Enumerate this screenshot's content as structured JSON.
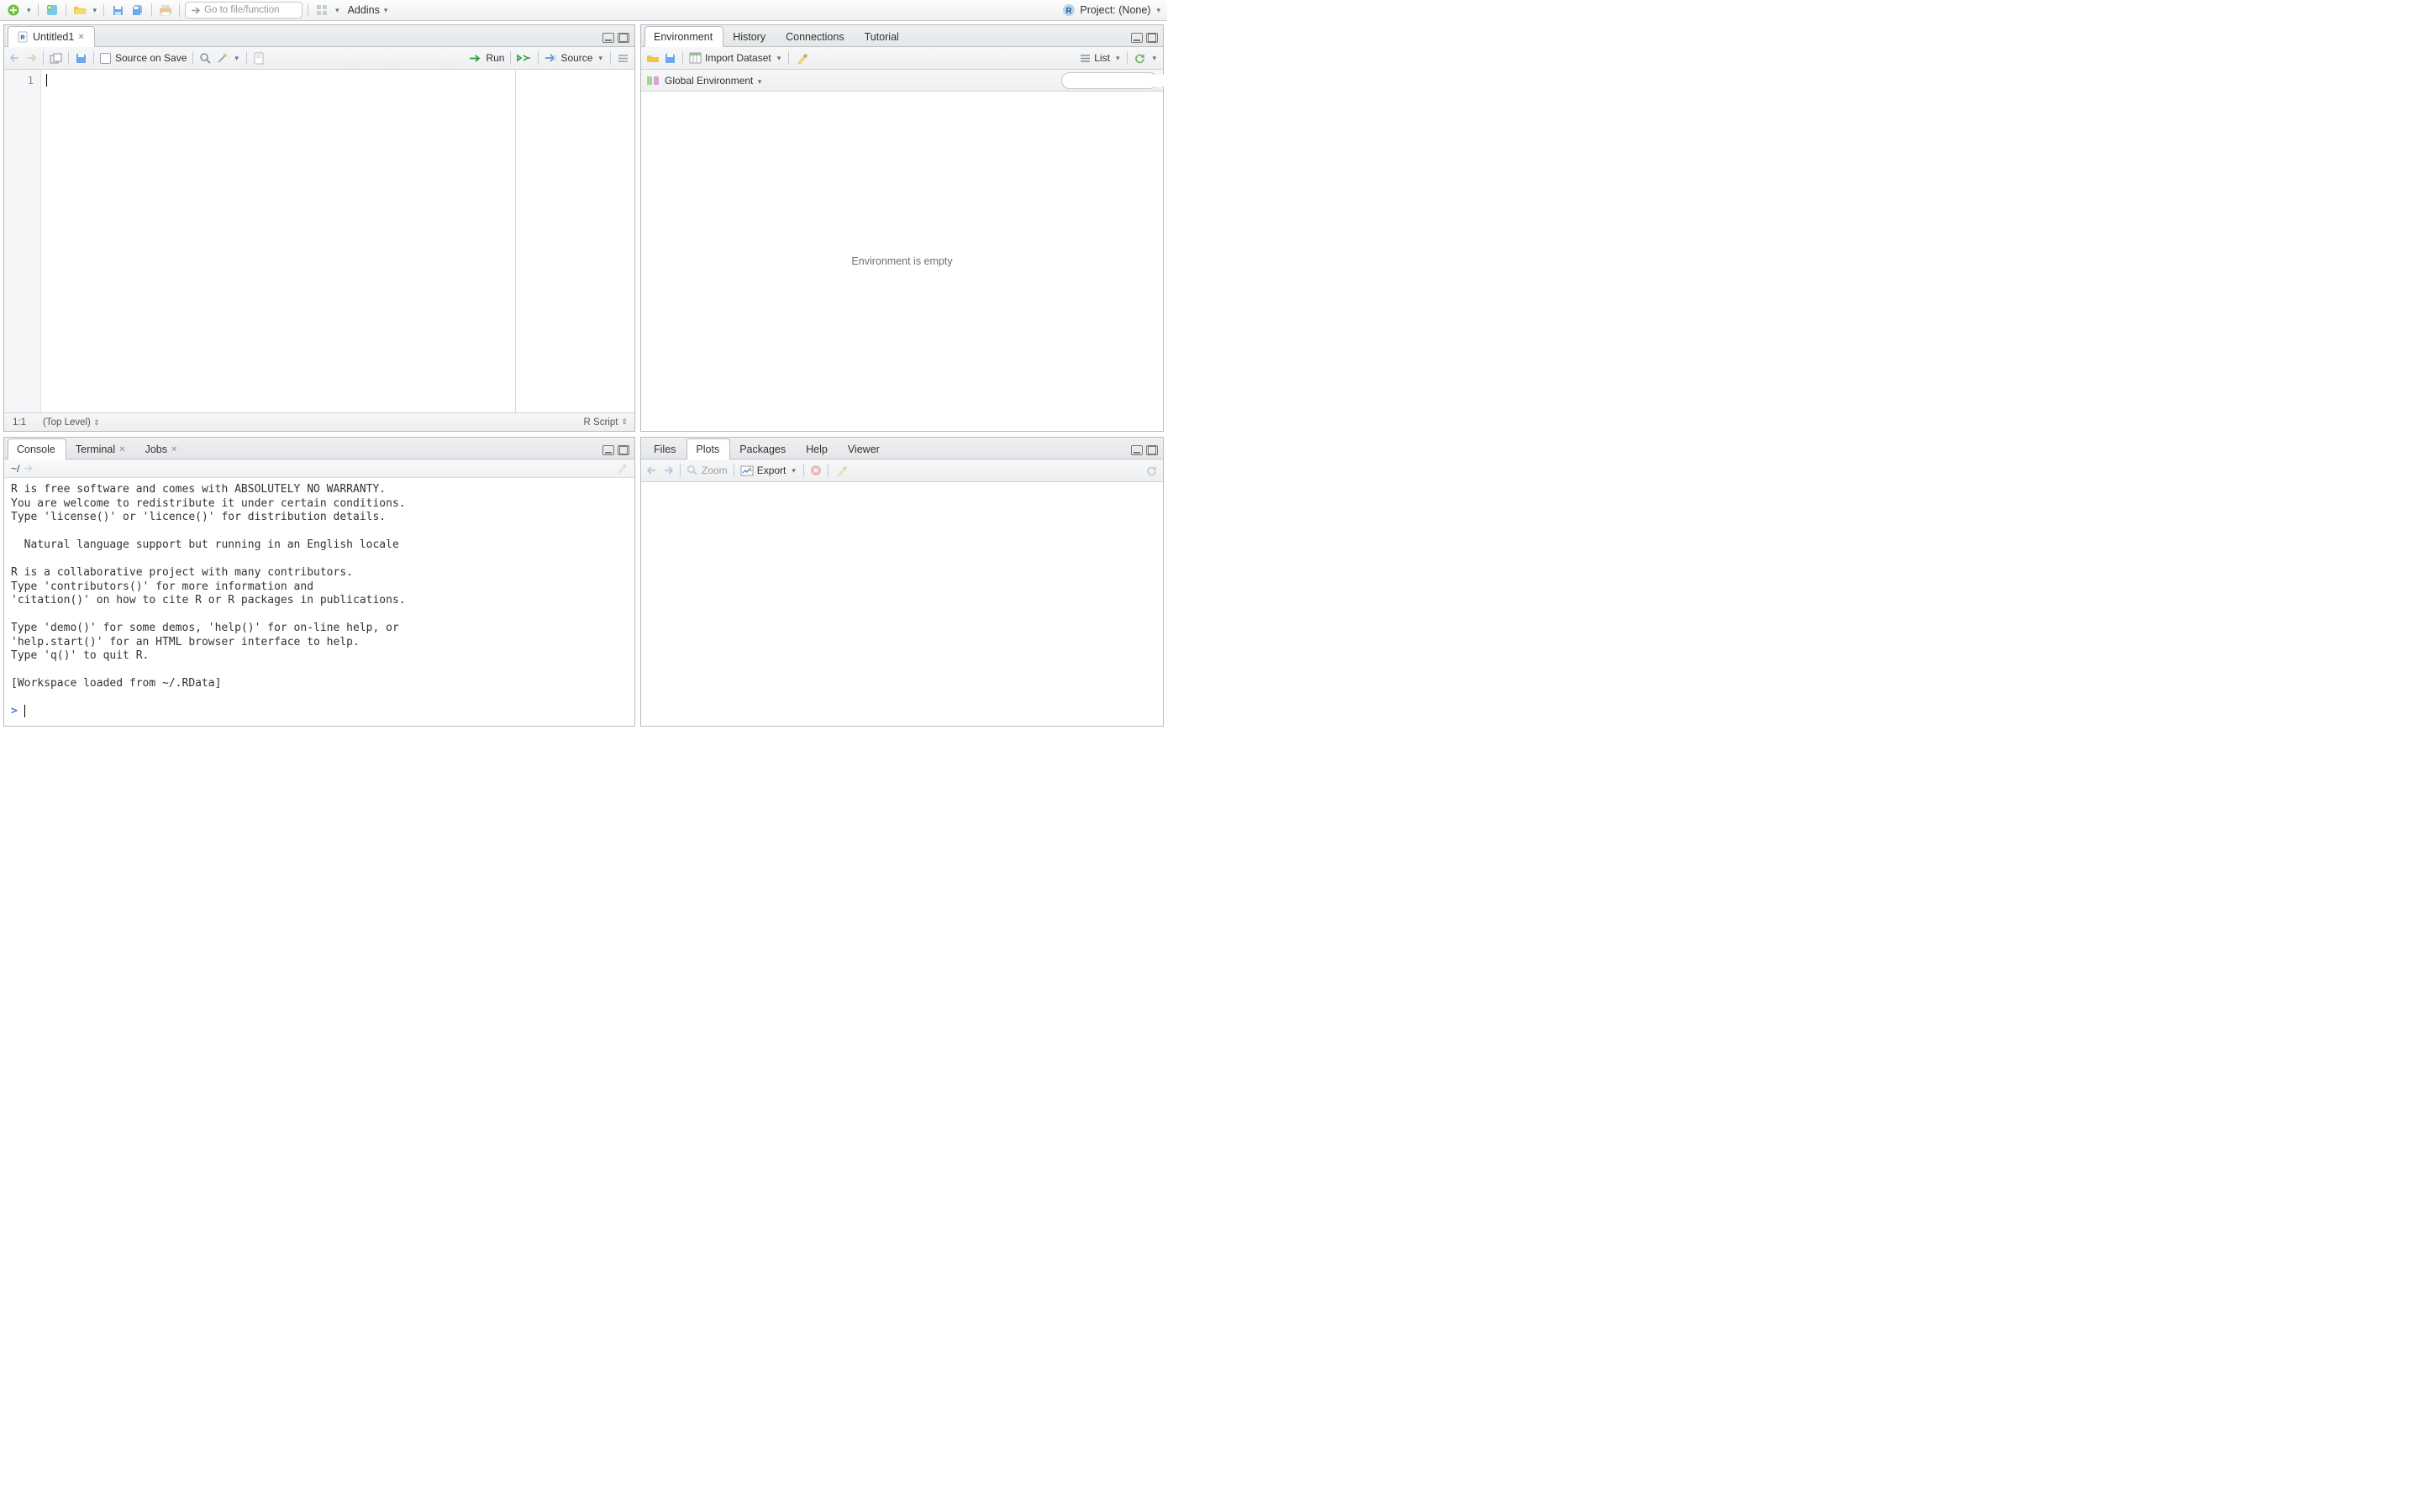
{
  "toolbar": {
    "goto_placeholder": "Go to file/function",
    "addins_label": "Addins",
    "project_label": "Project: (None)"
  },
  "source": {
    "tab_label": "Untitled1",
    "source_on_save": "Source on Save",
    "run": "Run",
    "source_btn": "Source",
    "gutter_line": "1",
    "status_pos": "1:1",
    "status_scope": "(Top Level)",
    "status_type": "R Script"
  },
  "console": {
    "tabs": {
      "console": "Console",
      "terminal": "Terminal",
      "jobs": "Jobs"
    },
    "path": "~/",
    "text": "R is free software and comes with ABSOLUTELY NO WARRANTY.\nYou are welcome to redistribute it under certain conditions.\nType 'license()' or 'licence()' for distribution details.\n\n  Natural language support but running in an English locale\n\nR is a collaborative project with many contributors.\nType 'contributors()' for more information and\n'citation()' on how to cite R or R packages in publications.\n\nType 'demo()' for some demos, 'help()' for on-line help, or\n'help.start()' for an HTML browser interface to help.\nType 'q()' to quit R.\n\n[Workspace loaded from ~/.RData]\n",
    "prompt": ">"
  },
  "env": {
    "tabs": {
      "environment": "Environment",
      "history": "History",
      "connections": "Connections",
      "tutorial": "Tutorial"
    },
    "import": "Import Dataset",
    "list_label": "List",
    "scope": "Global Environment",
    "empty": "Environment is empty"
  },
  "plots": {
    "tabs": {
      "files": "Files",
      "plots": "Plots",
      "packages": "Packages",
      "help": "Help",
      "viewer": "Viewer"
    },
    "zoom": "Zoom",
    "export": "Export"
  }
}
